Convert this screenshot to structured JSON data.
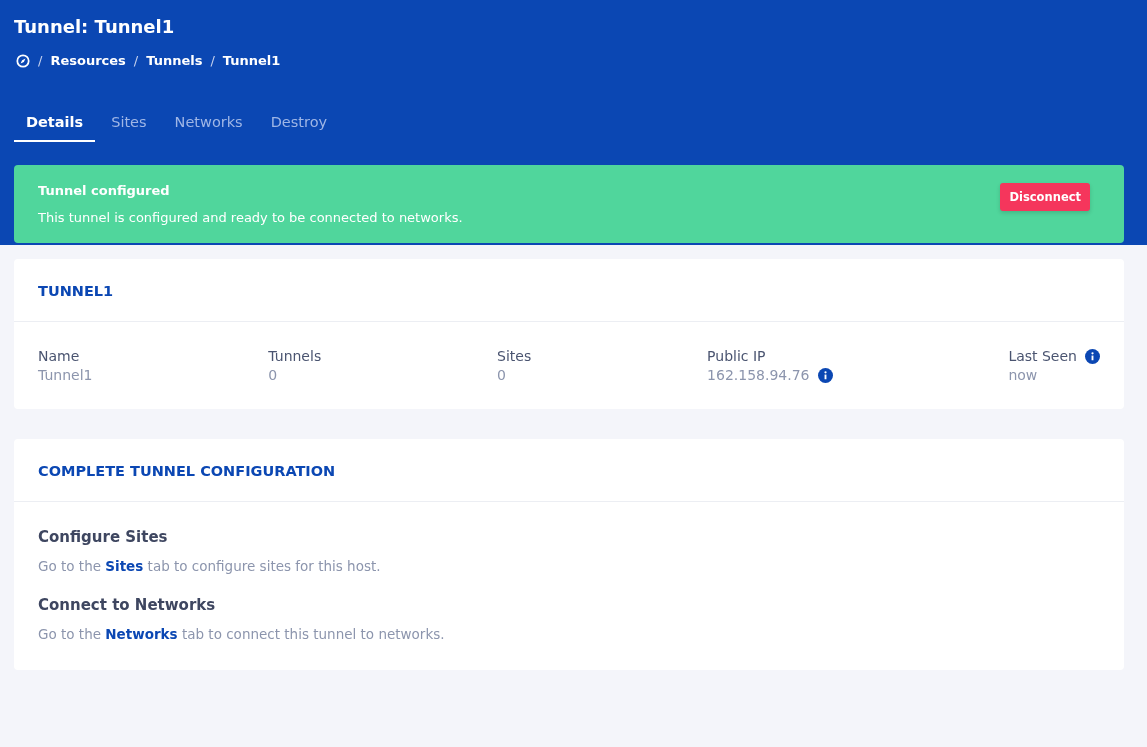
{
  "header": {
    "title": "Tunnel: Tunnel1",
    "breadcrumb": [
      "Resources",
      "Tunnels",
      "Tunnel1"
    ],
    "separator": "/"
  },
  "tabs": [
    {
      "label": "Details",
      "selected": true
    },
    {
      "label": "Sites",
      "selected": false
    },
    {
      "label": "Networks",
      "selected": false
    },
    {
      "label": "Destroy",
      "selected": false
    }
  ],
  "alert": {
    "title": "Tunnel configured",
    "message": "This tunnel is configured and ready to be connected to networks.",
    "button": "Disconnect"
  },
  "summary": {
    "title": "TUNNEL1",
    "stats": [
      {
        "label": "Name",
        "value": "Tunnel1",
        "label_info": false,
        "value_info": false
      },
      {
        "label": "Tunnels",
        "value": "0",
        "label_info": false,
        "value_info": false
      },
      {
        "label": "Sites",
        "value": "0",
        "label_info": false,
        "value_info": false
      },
      {
        "label": "Public IP",
        "value": "162.158.94.76",
        "label_info": false,
        "value_info": true
      },
      {
        "label": "Last Seen",
        "value": "now",
        "label_info": true,
        "value_info": false
      }
    ]
  },
  "configuration": {
    "title": "COMPLETE TUNNEL CONFIGURATION",
    "steps": [
      {
        "heading": "Configure Sites",
        "before": "Go to the",
        "link": "Sites",
        "after": "tab to configure sites for this host."
      },
      {
        "heading": "Connect to Networks",
        "before": "Go to the",
        "link": "Networks",
        "after": "tab to connect this tunnel to networks."
      }
    ]
  }
}
